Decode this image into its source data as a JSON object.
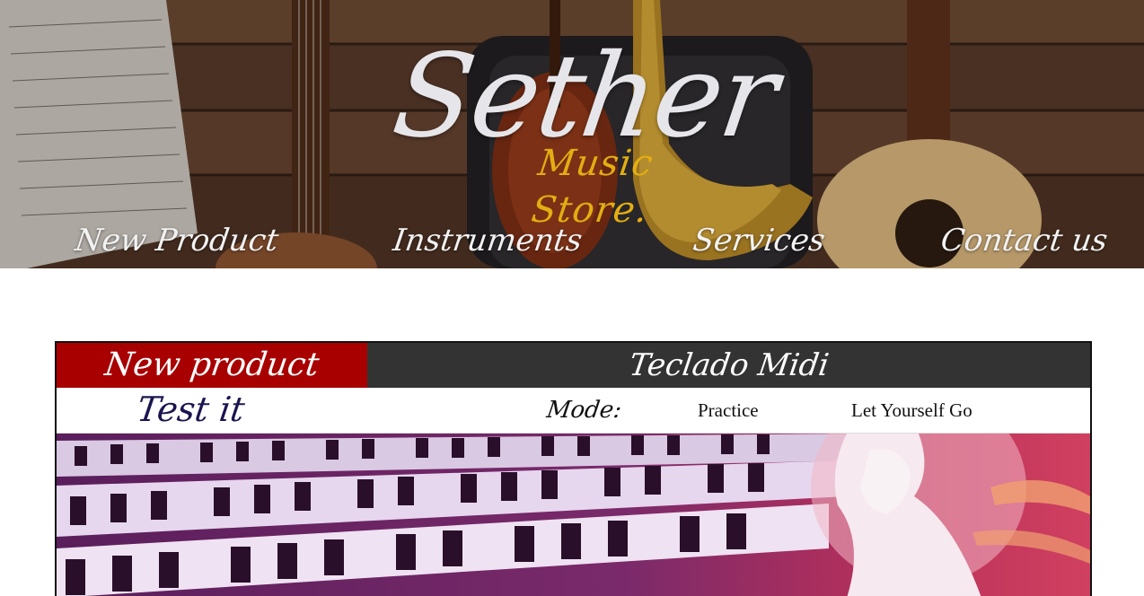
{
  "header": {
    "brand_title": "Sether",
    "brand_subtitle": "Music Store."
  },
  "nav": {
    "items": [
      {
        "label": "New Product"
      },
      {
        "label": "Instruments"
      },
      {
        "label": "Services"
      },
      {
        "label": "Contact us"
      }
    ]
  },
  "panel": {
    "tab_label": "New product",
    "product_name": "Teclado Midi",
    "test_label": "Test it",
    "mode_label": "Mode:",
    "mode_options": [
      "Practice",
      "Let Yourself Go"
    ]
  },
  "colors": {
    "brand_title": "#e6e6ea",
    "brand_subtitle": "#e3ae12",
    "tab_background": "#a80000",
    "product_bar": "#333333",
    "test_label": "#1a1550"
  }
}
